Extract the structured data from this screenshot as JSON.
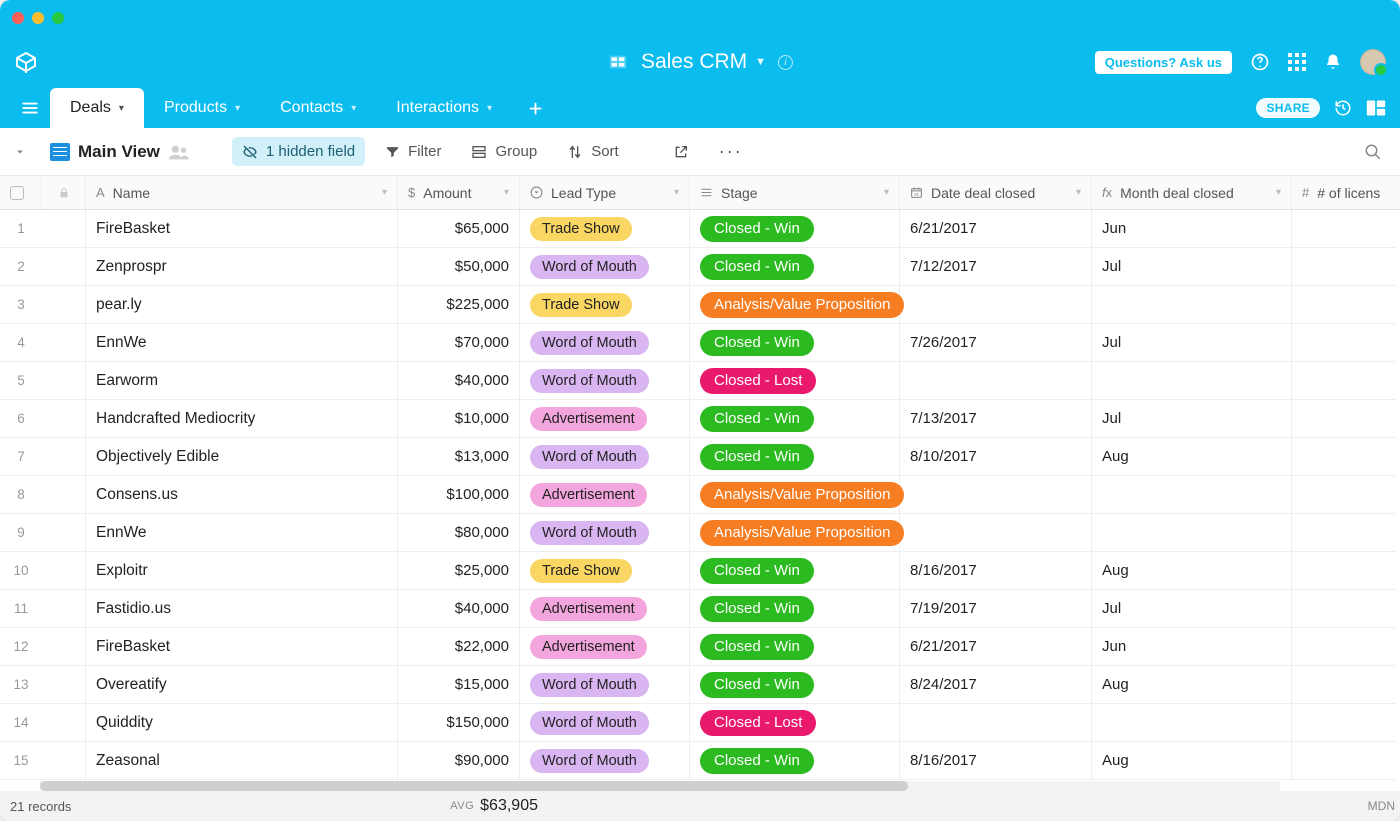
{
  "app": {
    "name": "Sales CRM"
  },
  "header_buttons": {
    "ask_label": "Questions? Ask us",
    "share_label": "SHARE"
  },
  "tabs": [
    {
      "label": "Deals",
      "active": true
    },
    {
      "label": "Products",
      "active": false
    },
    {
      "label": "Contacts",
      "active": false
    },
    {
      "label": "Interactions",
      "active": false
    }
  ],
  "toolbar": {
    "view_name": "Main View",
    "hidden_fields_label": "1 hidden field",
    "filter_label": "Filter",
    "group_label": "Group",
    "sort_label": "Sort"
  },
  "columns": [
    {
      "key": "name",
      "label": "Name",
      "icon": "text"
    },
    {
      "key": "amount",
      "label": "Amount",
      "icon": "currency"
    },
    {
      "key": "leadType",
      "label": "Lead Type",
      "icon": "select"
    },
    {
      "key": "stage",
      "label": "Stage",
      "icon": "select-bar"
    },
    {
      "key": "dateClosed",
      "label": "Date deal closed",
      "icon": "calendar"
    },
    {
      "key": "monthClosed",
      "label": "Month deal closed",
      "icon": "formula"
    },
    {
      "key": "licenses",
      "label": "# of licens",
      "icon": "hash"
    }
  ],
  "rows": [
    {
      "name": "FireBasket",
      "amount": "$65,000",
      "leadType": "Trade Show",
      "stage": "Closed - Win",
      "dateClosed": "6/21/2017",
      "monthClosed": "Jun"
    },
    {
      "name": "Zenprospr",
      "amount": "$50,000",
      "leadType": "Word of Mouth",
      "stage": "Closed - Win",
      "dateClosed": "7/12/2017",
      "monthClosed": "Jul"
    },
    {
      "name": "pear.ly",
      "amount": "$225,000",
      "leadType": "Trade Show",
      "stage": "Analysis/Value Proposition",
      "dateClosed": "",
      "monthClosed": ""
    },
    {
      "name": "EnnWe",
      "amount": "$70,000",
      "leadType": "Word of Mouth",
      "stage": "Closed - Win",
      "dateClosed": "7/26/2017",
      "monthClosed": "Jul"
    },
    {
      "name": "Earworm",
      "amount": "$40,000",
      "leadType": "Word of Mouth",
      "stage": "Closed - Lost",
      "dateClosed": "",
      "monthClosed": ""
    },
    {
      "name": "Handcrafted Mediocrity",
      "amount": "$10,000",
      "leadType": "Advertisement",
      "stage": "Closed - Win",
      "dateClosed": "7/13/2017",
      "monthClosed": "Jul"
    },
    {
      "name": "Objectively Edible",
      "amount": "$13,000",
      "leadType": "Word of Mouth",
      "stage": "Closed - Win",
      "dateClosed": "8/10/2017",
      "monthClosed": "Aug"
    },
    {
      "name": "Consens.us",
      "amount": "$100,000",
      "leadType": "Advertisement",
      "stage": "Analysis/Value Proposition",
      "dateClosed": "",
      "monthClosed": ""
    },
    {
      "name": "EnnWe",
      "amount": "$80,000",
      "leadType": "Word of Mouth",
      "stage": "Analysis/Value Proposition",
      "dateClosed": "",
      "monthClosed": ""
    },
    {
      "name": "Exploitr",
      "amount": "$25,000",
      "leadType": "Trade Show",
      "stage": "Closed - Win",
      "dateClosed": "8/16/2017",
      "monthClosed": "Aug"
    },
    {
      "name": "Fastidio.us",
      "amount": "$40,000",
      "leadType": "Advertisement",
      "stage": "Closed - Win",
      "dateClosed": "7/19/2017",
      "monthClosed": "Jul"
    },
    {
      "name": "FireBasket",
      "amount": "$22,000",
      "leadType": "Advertisement",
      "stage": "Closed - Win",
      "dateClosed": "6/21/2017",
      "monthClosed": "Jun"
    },
    {
      "name": "Overeatify",
      "amount": "$15,000",
      "leadType": "Word of Mouth",
      "stage": "Closed - Win",
      "dateClosed": "8/24/2017",
      "monthClosed": "Aug"
    },
    {
      "name": "Quiddity",
      "amount": "$150,000",
      "leadType": "Word of Mouth",
      "stage": "Closed - Lost",
      "dateClosed": "",
      "monthClosed": ""
    },
    {
      "name": "Zeasonal",
      "amount": "$90,000",
      "leadType": "Word of Mouth",
      "stage": "Closed - Win",
      "dateClosed": "8/16/2017",
      "monthClosed": "Aug"
    }
  ],
  "footer": {
    "record_count_label": "21 records",
    "summary_label": "AVG",
    "summary_value": "$63,905",
    "right_label": "MDN"
  }
}
